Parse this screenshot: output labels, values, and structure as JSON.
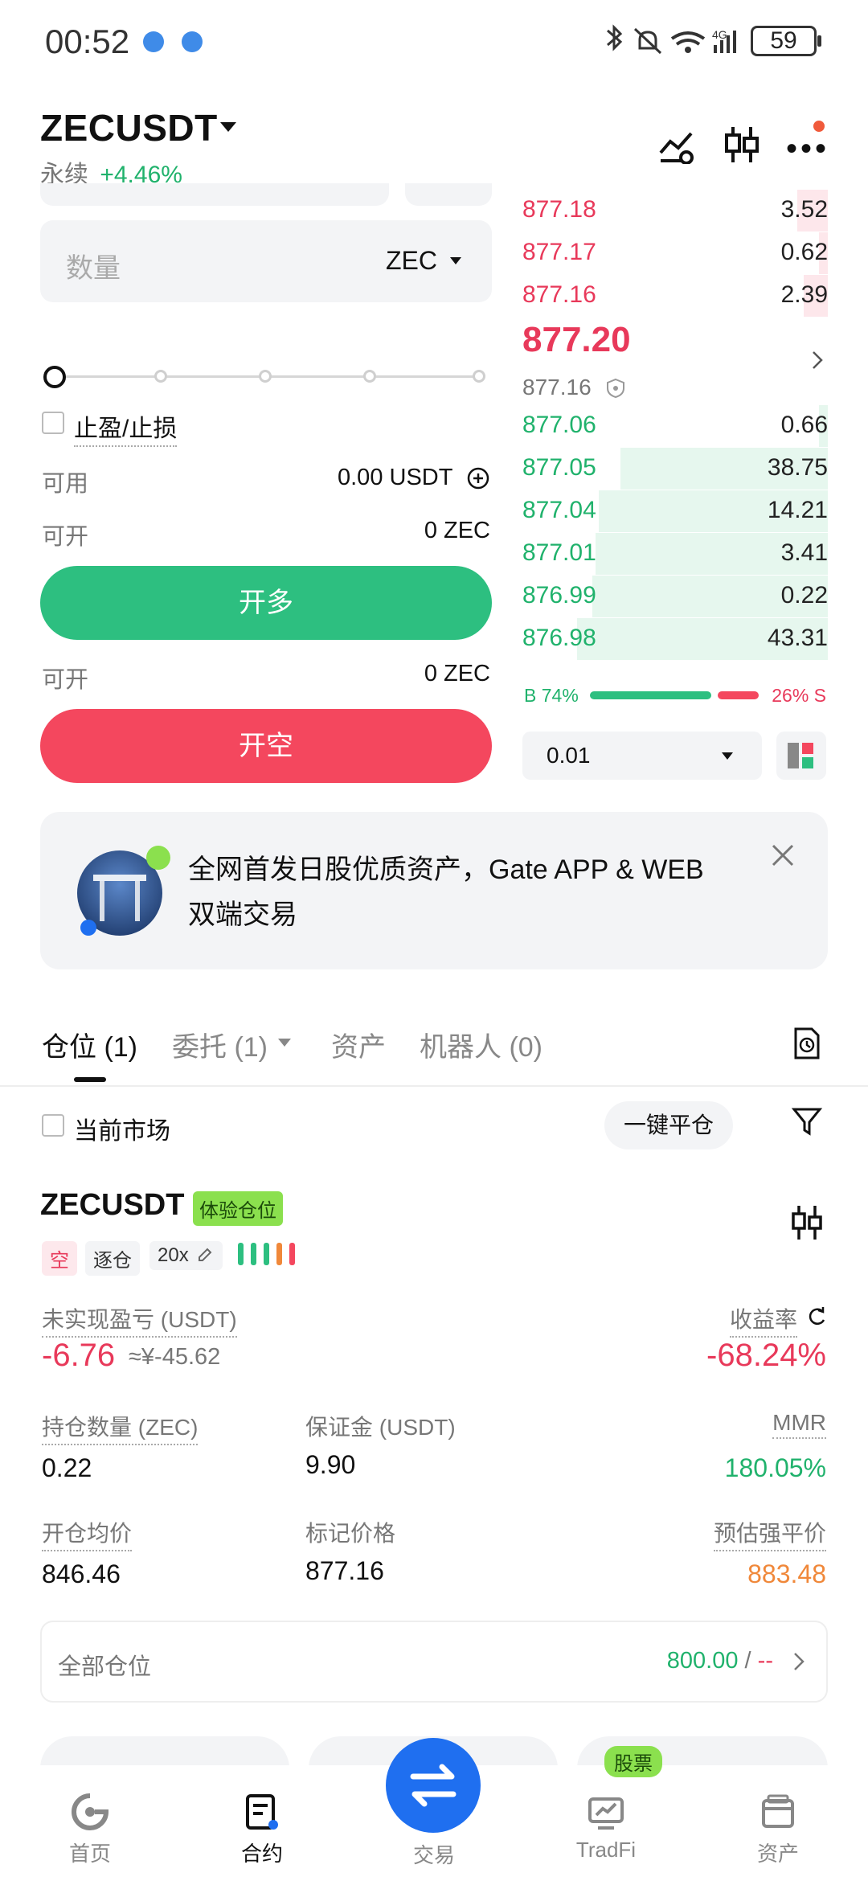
{
  "status_bar": {
    "time": "00:52",
    "battery": "59"
  },
  "header": {
    "pair": "ZECUSDT",
    "type": "永续",
    "change": "+4.46%"
  },
  "order_form": {
    "qty_placeholder": "数量",
    "qty_unit": "ZEC",
    "tp_sl_label": "止盈/止损",
    "available_label": "可用",
    "available_value": "0.00 USDT",
    "can_open_label": "可开",
    "can_open_long_value": "0 ZEC",
    "long_button": "开多",
    "can_open_short_value": "0 ZEC",
    "short_button": "开空"
  },
  "order_book": {
    "asks": [
      {
        "price": "877.18",
        "qty": "3.52",
        "depth": 0.1
      },
      {
        "price": "877.17",
        "qty": "0.62",
        "depth": 0.03
      },
      {
        "price": "877.16",
        "qty": "2.39",
        "depth": 0.08
      }
    ],
    "last_price": "877.20",
    "mark_price": "877.16",
    "bids": [
      {
        "price": "877.06",
        "qty": "0.66",
        "depth": 0.03
      },
      {
        "price": "877.05",
        "qty": "38.75",
        "depth": 0.68
      },
      {
        "price": "877.04",
        "qty": "14.21",
        "depth": 0.75
      },
      {
        "price": "877.01",
        "qty": "3.41",
        "depth": 0.76
      },
      {
        "price": "876.99",
        "qty": "0.22",
        "depth": 0.77
      },
      {
        "price": "876.98",
        "qty": "43.31",
        "depth": 0.82
      }
    ],
    "buy_ratio_label": "B 74%",
    "sell_ratio_label": "26% S",
    "buy_ratio": 0.74,
    "precision": "0.01"
  },
  "banner": {
    "text_line1": "全网首发日股优质资产，Gate APP & WEB",
    "text_line2": "双端交易"
  },
  "tabs": [
    {
      "label": "仓位 (1)"
    },
    {
      "label": "委托 (1)"
    },
    {
      "label": "资产"
    },
    {
      "label": "机器人 (0)"
    }
  ],
  "filters": {
    "current_market": "当前市场",
    "close_all": "一键平仓"
  },
  "position": {
    "symbol": "ZECUSDT",
    "trial_tag": "体验仓位",
    "side": "空",
    "margin_mode": "逐仓",
    "leverage": "20x",
    "unrealized_label": "未实现盈亏 (USDT)",
    "unrealized_value": "-6.76",
    "unrealized_cny": "≈¥-45.62",
    "roe_label": "收益率",
    "roe_value": "-68.24%",
    "size_label": "持仓数量 (ZEC)",
    "size_value": "0.22",
    "margin_label": "保证金 (USDT)",
    "margin_value": "9.90",
    "mmr_label": "MMR",
    "mmr_value": "180.05%",
    "entry_label": "开仓均价",
    "entry_value": "846.46",
    "mark_label": "标记价格",
    "mark_value": "877.16",
    "liq_label": "预估强平价",
    "liq_value": "883.48"
  },
  "all_positions": {
    "label": "全部仓位",
    "value": "800.00",
    "sep": " / ",
    "value2": "--"
  },
  "nav": [
    {
      "label": "首页"
    },
    {
      "label": "合约"
    },
    {
      "label": "交易"
    },
    {
      "label": "TradFi"
    },
    {
      "label": "资产"
    }
  ],
  "nav_badge": "股票",
  "colors": {
    "green": "#20b26c",
    "red": "#e8395a",
    "blue": "#1f6ff0",
    "orange": "#f0883a"
  }
}
